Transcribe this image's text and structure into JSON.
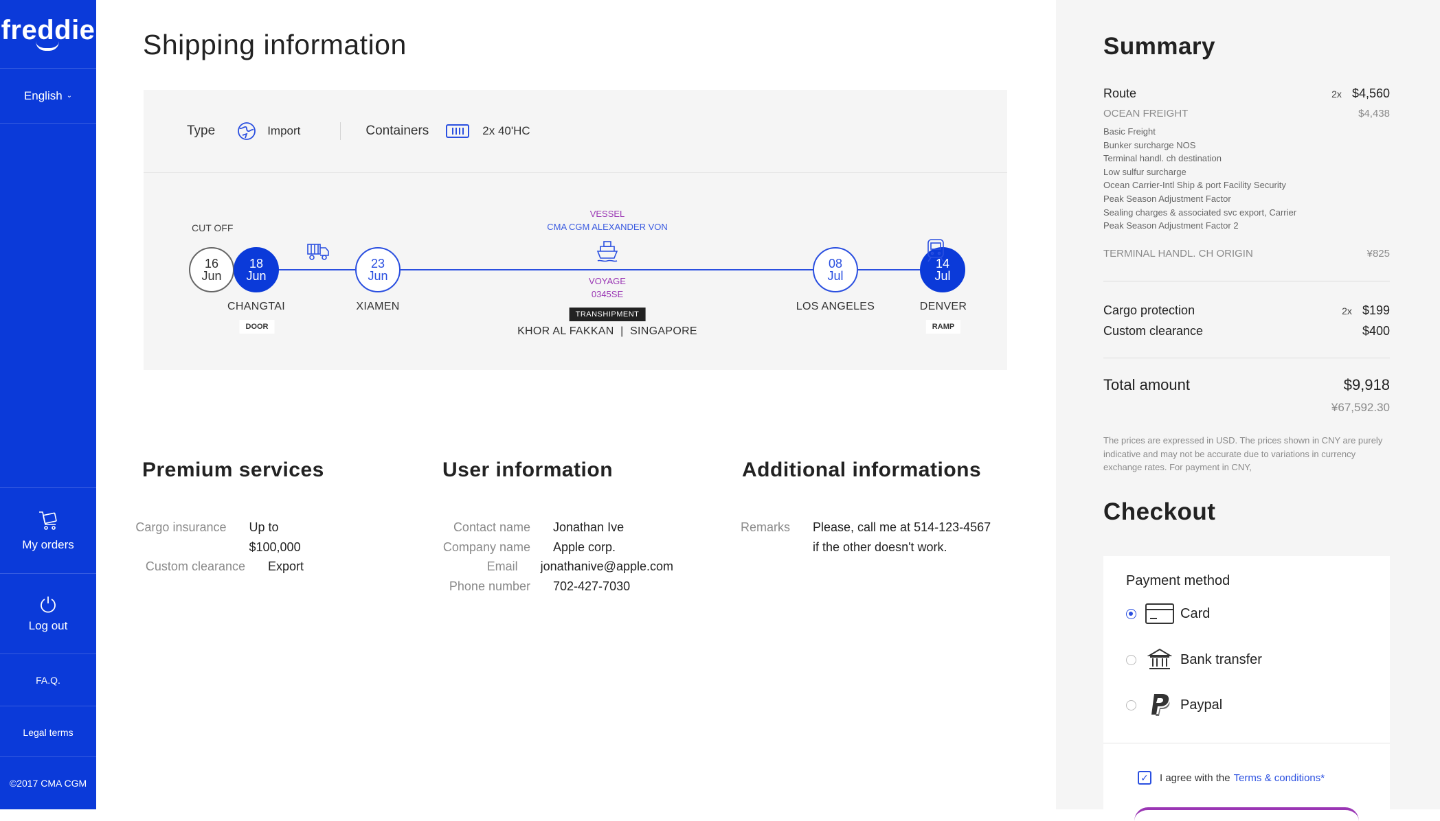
{
  "sidebar": {
    "logo": "freddie",
    "language": "English",
    "nav": [
      {
        "label": "My orders",
        "icon": "cart-icon"
      },
      {
        "label": "Log out",
        "icon": "power-icon"
      },
      {
        "label": "FA.Q."
      },
      {
        "label": "Legal terms"
      }
    ],
    "copyright": "©2017 CMA CGM"
  },
  "main": {
    "title": "Shipping information",
    "shipment": {
      "type_label": "Type",
      "type_value": "Import",
      "containers_label": "Containers",
      "containers_value": "2x 40'HC",
      "cutoff_label": "CUT OFF",
      "stops": [
        {
          "day": "16",
          "month": "Jun",
          "style": "gray"
        },
        {
          "day": "18",
          "month": "Jun",
          "style": "filled"
        },
        {
          "day": "23",
          "month": "Jun",
          "style": "outline"
        },
        {
          "day": "08",
          "month": "Jul",
          "style": "outline"
        },
        {
          "day": "14",
          "month": "Jul",
          "style": "filled"
        }
      ],
      "places": {
        "changtai": "CHANGTAI",
        "xiamen": "XIAMEN",
        "los_angeles": "LOS ANGELES",
        "denver": "DENVER",
        "transhipment": "KHOR AL FAKKAN  |  SINGAPORE"
      },
      "tags": {
        "door": "DOOR",
        "ramp": "RAMP",
        "transhipment": "TRANSHIPMENT"
      },
      "vessel_label": "VESSEL",
      "vessel_name": "CMA CGM ALEXANDER VON",
      "voyage_label": "VOYAGE",
      "voyage_number": "0345SE"
    },
    "premium": {
      "title": "Premium services",
      "rows": [
        {
          "k": "Cargo insurance",
          "v": "Up to $100,000"
        },
        {
          "k": "Custom clearance",
          "v": "Export"
        }
      ]
    },
    "user": {
      "title": "User information",
      "rows": [
        {
          "k": "Contact name",
          "v": "Jonathan Ive"
        },
        {
          "k": "Company name",
          "v": "Apple corp."
        },
        {
          "k": "Email",
          "v": "jonathanive@apple.com"
        },
        {
          "k": "Phone number",
          "v": "702-427-7030"
        }
      ]
    },
    "additional": {
      "title": "Additional informations",
      "remarks_label": "Remarks",
      "remarks_line1": "Please, call me at 514-123-4567",
      "remarks_line2": "if the other doesn't work."
    }
  },
  "summary": {
    "title": "Summary",
    "route_label": "Route",
    "route_qty": "2x",
    "route_price": "$4,560",
    "ocean_label": "OCEAN FREIGHT",
    "ocean_price": "$4,438",
    "fees": [
      "Basic Freight",
      "Bunker surcharge NOS",
      "Terminal handl. ch  destination",
      "Low sulfur surcharge",
      "Ocean Carrier-Intl Ship & port Facility Security",
      "Peak Season Adjustment Factor",
      "Sealing charges & associated svc export, Carrier",
      "Peak Season Adjustment Factor 2"
    ],
    "terminal_label": "TERMINAL HANDL. CH ORIGIN",
    "terminal_price": "¥825",
    "cargo_label": "Cargo protection",
    "cargo_qty": "2x",
    "cargo_price": "$199",
    "custom_label": "Custom clearance",
    "custom_price": "$400",
    "total_label": "Total amount",
    "total_price": "$9,918",
    "total_cny": "¥67,592.30",
    "note": "The prices are expressed in USD. The prices shown in CNY are purely indicative and may not be accurate due to variations in currency exchange rates. For payment in CNY,"
  },
  "checkout": {
    "title": "Checkout",
    "payment_title": "Payment method",
    "options": [
      {
        "label": "Card",
        "selected": true,
        "icon": "card-icon"
      },
      {
        "label": "Bank transfer",
        "selected": false,
        "icon": "bank-icon"
      },
      {
        "label": "Paypal",
        "selected": false,
        "icon": "paypal-icon"
      }
    ],
    "agree_text": "I agree with the",
    "terms_link": "Terms & conditions*"
  },
  "colors": {
    "brand": "#0b3ad9",
    "accent": "#2a4fe0",
    "purple": "#9a36b4"
  }
}
